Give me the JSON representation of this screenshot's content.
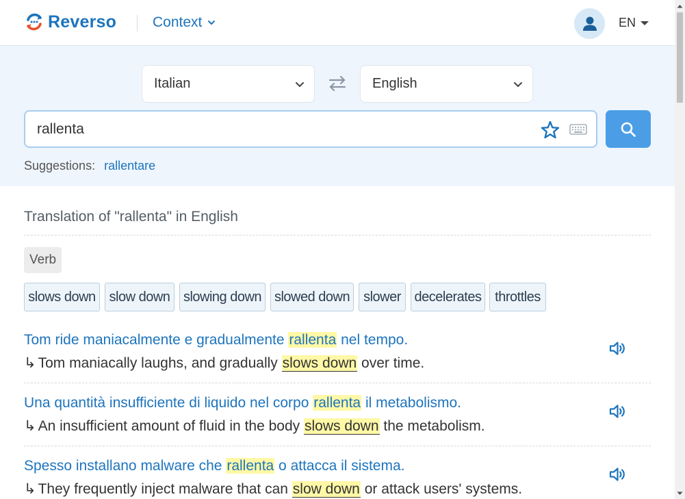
{
  "header": {
    "logo_text": "Reverso",
    "product_label": "Context",
    "ui_language": "EN"
  },
  "search": {
    "source_language": "Italian",
    "target_language": "English",
    "query": "rallenta",
    "suggestions_label": "Suggestions:",
    "suggestion": "rallentare"
  },
  "results": {
    "heading": "Translation of \"rallenta\" in English",
    "part_of_speech": "Verb",
    "translations": [
      "slows down",
      "slow down",
      "slowing down",
      "slowed down",
      "slower",
      "decelerates",
      "throttles"
    ],
    "examples": [
      {
        "src_before": "Tom ride maniacalmente e gradualmente ",
        "src_hl": "rallenta",
        "src_after": " nel tempo.",
        "tgt_before": "Tom maniacally laughs, and gradually ",
        "tgt_hl": "slows down",
        "tgt_after": " over time."
      },
      {
        "src_before": "Una quantità insufficiente di liquido nel corpo ",
        "src_hl": "rallenta",
        "src_after": " il metabolismo.",
        "tgt_before": "An insufficient amount of fluid in the body ",
        "tgt_hl": "slows down",
        "tgt_after": " the metabolism."
      },
      {
        "src_before": "Spesso installano malware che ",
        "src_hl": "rallenta",
        "src_after": " o attacca il sistema.",
        "tgt_before": "They frequently inject malware that can ",
        "tgt_hl": "slow down",
        "tgt_after": " or attack users' systems."
      }
    ]
  },
  "colors": {
    "brand_blue": "#1d74bd",
    "search_button": "#4b9ee6",
    "panel_bg": "#eef5fc",
    "highlight": "#fff8a6"
  },
  "icons": {
    "logo": "reverso-logo-icon",
    "avatar": "user-icon",
    "swap": "swap-icon",
    "favorite": "star-icon",
    "keyboard": "keyboard-icon",
    "search": "search-icon",
    "speaker": "speaker-icon"
  }
}
